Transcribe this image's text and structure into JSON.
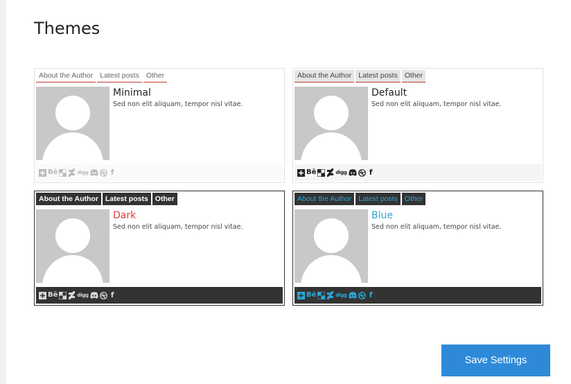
{
  "page": {
    "title": "Themes"
  },
  "tabs": {
    "about": "About the Author",
    "latest": "Latest posts",
    "other": "Other"
  },
  "sample_description": "Sed non elit aliquam, tempor nisl vitae.",
  "themes": [
    {
      "id": "minimal",
      "name": "Minimal"
    },
    {
      "id": "default",
      "name": "Default"
    },
    {
      "id": "dark",
      "name": "Dark"
    },
    {
      "id": "blue",
      "name": "Blue"
    }
  ],
  "social_icons": {
    "add": "plus-square-icon",
    "behance": "Bē",
    "delicious": "delicious-icon",
    "deviantart": "deviantart-icon",
    "digg": "digg",
    "discord": "discord-icon",
    "dribbble": "dribbble-icon",
    "facebook": "f"
  },
  "colors": {
    "accent_red": "#c0392b",
    "dark_name": "#e03b3b",
    "blue_accent": "#2aa8d6",
    "button": "#2e8ad8"
  },
  "actions": {
    "save_label": "Save Settings"
  }
}
